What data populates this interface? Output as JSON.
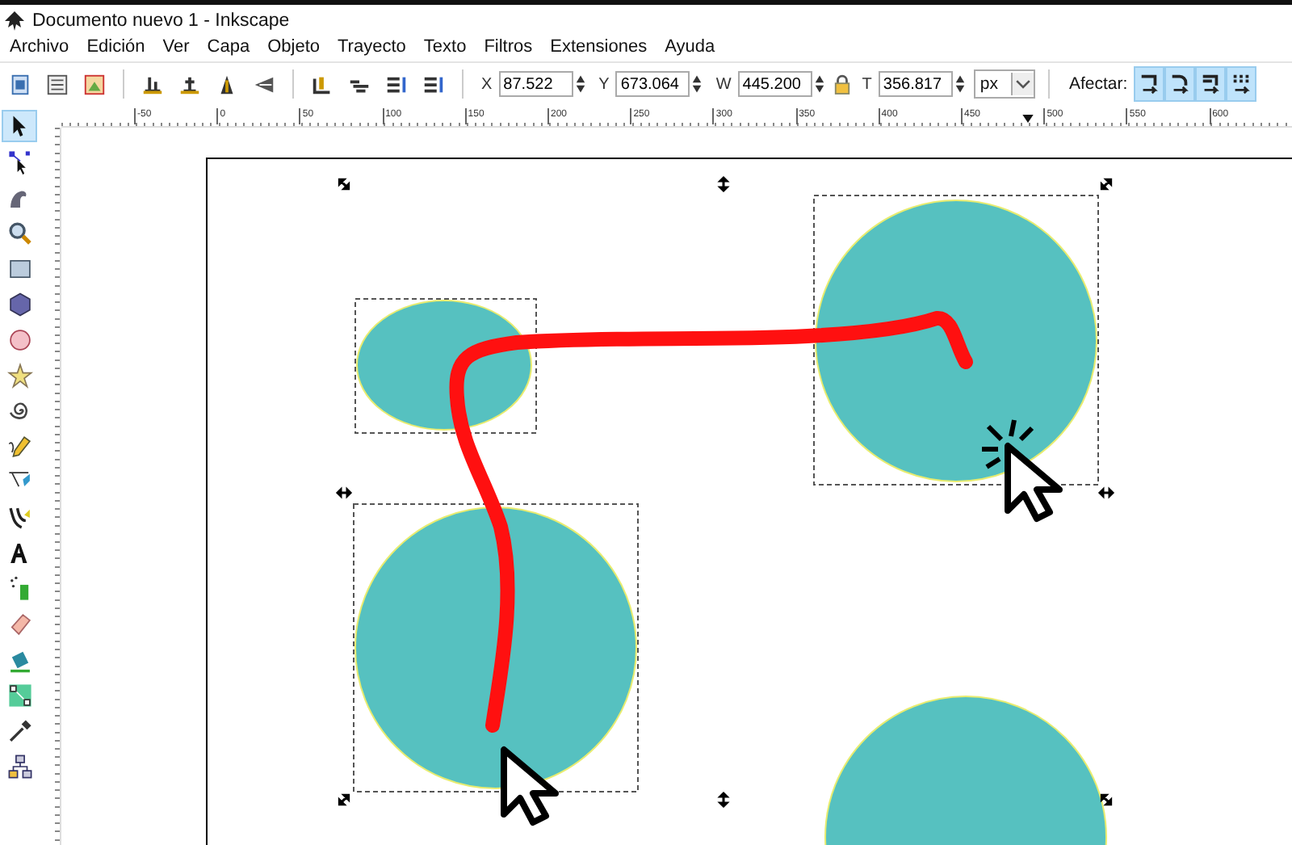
{
  "window": {
    "title": "Documento nuevo 1 - Inkscape"
  },
  "menu": [
    "Archivo",
    "Edición",
    "Ver",
    "Capa",
    "Objeto",
    "Trayecto",
    "Texto",
    "Filtros",
    "Extensiones",
    "Ayuda"
  ],
  "toolbar": {
    "fields": [
      {
        "label": "X",
        "value": "87.522"
      },
      {
        "label": "Y",
        "value": "673.064"
      },
      {
        "label": "W",
        "value": "445.200"
      },
      {
        "label": "T",
        "value": "356.817"
      }
    ],
    "unit": "px",
    "affect_label": "Afectar:",
    "affect_buttons": [
      {
        "selected": true
      },
      {
        "selected": true
      },
      {
        "selected": true
      },
      {
        "selected": true
      }
    ]
  },
  "ruler": {
    "labels": [
      "-50",
      "0",
      "50",
      "100",
      "150",
      "200",
      "250",
      "300",
      "350",
      "400",
      "450",
      "500",
      "550",
      "600"
    ]
  },
  "tools": [
    {
      "selected": true
    },
    {
      "selected": false
    },
    {
      "selected": false
    },
    {
      "selected": false
    },
    {
      "selected": false
    },
    {
      "selected": false
    },
    {
      "selected": false
    },
    {
      "selected": false
    },
    {
      "selected": false
    },
    {
      "selected": false
    },
    {
      "selected": false
    },
    {
      "selected": false
    },
    {
      "selected": false
    },
    {
      "selected": false
    },
    {
      "selected": false
    },
    {
      "selected": false
    },
    {
      "selected": false
    },
    {
      "selected": false
    },
    {
      "selected": false
    }
  ]
}
